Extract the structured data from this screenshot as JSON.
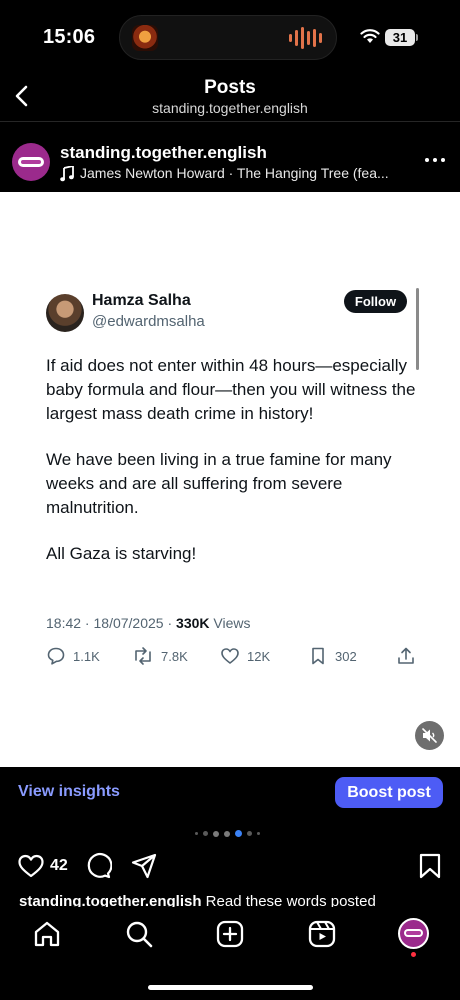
{
  "status_bar": {
    "time": "15:06",
    "battery": "31"
  },
  "header": {
    "title": "Posts",
    "subtitle": "standing.together.english"
  },
  "post": {
    "author": "standing.together.english",
    "music": "James Newton Howard · The Hanging Tree (fea..."
  },
  "tweet": {
    "name": "Hamza Salha",
    "handle": "@edwardmsalha",
    "follow_label": "Follow",
    "paragraphs": [
      "If aid does not enter within 48 hours—especially baby formula and flour—then you will witness the largest mass death crime in history!",
      "We have been living in a true famine for many weeks and are all suffering from severe malnutrition.",
      "All Gaza is starving!"
    ],
    "time": "18:42",
    "date": "18/07/2025",
    "views_count": "330K",
    "views_label": "Views",
    "replies": "1.1K",
    "reposts": "7.8K",
    "likes": "12K",
    "bookmarks": "302"
  },
  "insights": {
    "view_label": "View insights",
    "boost_label": "Boost post"
  },
  "actions": {
    "like_count": "42"
  },
  "caption": {
    "username": "standing.together.english",
    "text": " Read these words posted"
  },
  "colors": {
    "accent": "#4d5cf5",
    "link": "#8a9bff",
    "brand_avatar": "#9b2a8c",
    "notification": "#ff3040"
  }
}
